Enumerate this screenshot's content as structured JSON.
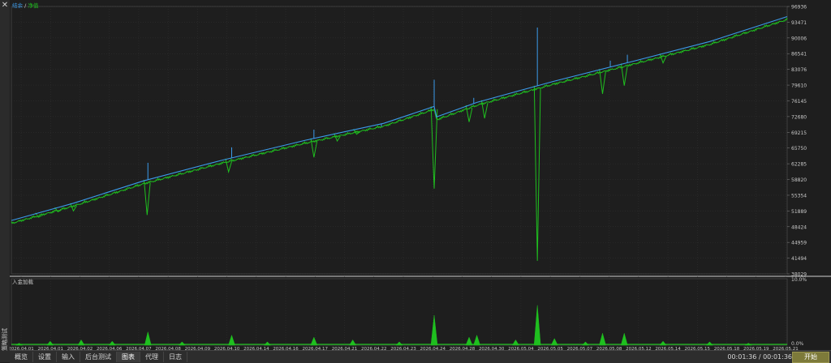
{
  "window": {
    "close_glyph": "✕",
    "side_label": "策略测试"
  },
  "legend": {
    "balance_label": "结余",
    "separator": " / ",
    "equity_label": "净值"
  },
  "sub_panel": {
    "title": "入金加载"
  },
  "colors": {
    "background": "#1e1e1e",
    "grid": "#3a3a3a",
    "balance": "#3b9bea",
    "equity": "#1fbf1f",
    "text": "#c8c8c8",
    "start_button": "#7d7a3a"
  },
  "tabs": [
    {
      "label": "概览",
      "active": false
    },
    {
      "label": "设置",
      "active": false
    },
    {
      "label": "输入",
      "active": false
    },
    {
      "label": "后台测试",
      "active": false
    },
    {
      "label": "图表",
      "active": true
    },
    {
      "label": "代理",
      "active": false
    },
    {
      "label": "日志",
      "active": false
    }
  ],
  "status": {
    "timer": "00:01:36 / 00:01:36",
    "start_label": "开始"
  },
  "chart_data": {
    "type": "line",
    "main": {
      "y_ticks": [
        "96936",
        "93471",
        "90006",
        "86541",
        "83076",
        "79610",
        "76145",
        "72680",
        "69215",
        "65750",
        "62285",
        "58820",
        "55354",
        "51889",
        "48424",
        "44959",
        "41494",
        "38029"
      ],
      "y_min": 38029,
      "y_max": 96936,
      "x_labels": [
        "2026.04.01",
        "2026.04.01",
        "2026.04.02",
        "2026.04.06",
        "2026.04.07",
        "2026.04.08",
        "2026.04.09",
        "2026.04.10",
        "2026.04.14",
        "2026.04.16",
        "2026.04.17",
        "2026.04.21",
        "2026.04.22",
        "2026.04.23",
        "2026.04.24",
        "2026.04.28",
        "2026.04.30",
        "2026.05.04",
        "2026.05.05",
        "2026.05.07",
        "2026.05.08",
        "2026.05.12",
        "2026.05.14",
        "2026.05.15",
        "2026.05.18",
        "2026.05.19",
        "2026.05.21"
      ],
      "series": [
        {
          "name": "结余",
          "color": "#3b9bea",
          "points": [
            [
              0,
              49800
            ],
            [
              0.08,
              53600
            ],
            [
              0.17,
              58500
            ],
            [
              0.27,
              63000
            ],
            [
              0.38,
              67500
            ],
            [
              0.48,
              71200
            ],
            [
              0.545,
              74900
            ],
            [
              0.548,
              72600
            ],
            [
              0.6,
              75800
            ],
            [
              0.7,
              80500
            ],
            [
              0.8,
              84800
            ],
            [
              0.9,
              89200
            ],
            [
              1.0,
              94700
            ]
          ],
          "spikes": [
            [
              0.176,
              62500
            ],
            [
              0.284,
              65900
            ],
            [
              0.39,
              69800
            ],
            [
              0.477,
              70500
            ],
            [
              0.545,
              80800
            ],
            [
              0.596,
              76800
            ],
            [
              0.678,
              92300
            ],
            [
              0.772,
              85000
            ],
            [
              0.794,
              86300
            ]
          ]
        },
        {
          "name": "净值",
          "color": "#1fbf1f",
          "dips": [
            [
              0.035,
              50500
            ],
            [
              0.06,
              51700
            ],
            [
              0.08,
              51900
            ],
            [
              0.175,
              51000
            ],
            [
              0.28,
              60500
            ],
            [
              0.39,
              63700
            ],
            [
              0.42,
              67300
            ],
            [
              0.445,
              68800
            ],
            [
              0.545,
              56800
            ],
            [
              0.59,
              71500
            ],
            [
              0.61,
              72300
            ],
            [
              0.678,
              40900
            ],
            [
              0.762,
              77700
            ],
            [
              0.79,
              79500
            ],
            [
              0.84,
              84500
            ]
          ]
        }
      ]
    },
    "sub": {
      "y_ticks": [
        "10.0%",
        "0.0%"
      ],
      "y_min": 0,
      "y_max": 10,
      "spikes": [
        [
          0.01,
          0.3
        ],
        [
          0.05,
          0.6
        ],
        [
          0.09,
          0.8
        ],
        [
          0.13,
          0.6
        ],
        [
          0.176,
          2.0
        ],
        [
          0.22,
          0.5
        ],
        [
          0.284,
          1.5
        ],
        [
          0.33,
          0.5
        ],
        [
          0.39,
          1.2
        ],
        [
          0.44,
          0.8
        ],
        [
          0.5,
          0.5
        ],
        [
          0.545,
          4.5
        ],
        [
          0.59,
          1.2
        ],
        [
          0.6,
          1.5
        ],
        [
          0.65,
          0.8
        ],
        [
          0.678,
          6.0
        ],
        [
          0.7,
          1.0
        ],
        [
          0.74,
          0.5
        ],
        [
          0.762,
          1.8
        ],
        [
          0.79,
          1.8
        ],
        [
          0.84,
          0.6
        ],
        [
          0.9,
          0.5
        ],
        [
          0.95,
          0.3
        ]
      ]
    }
  }
}
